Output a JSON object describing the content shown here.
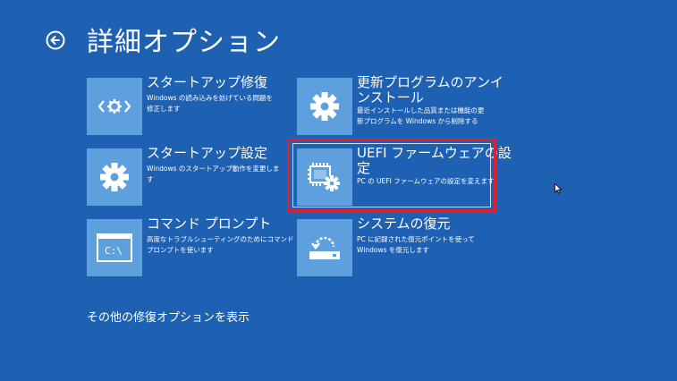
{
  "page": {
    "title": "詳細オプション",
    "more_options": "その他の修復オプションを表示"
  },
  "options": [
    {
      "title": "スタートアップ修復",
      "desc1": "Windows の読み込みを妨げている問題を",
      "desc2": "修正します",
      "icon": "repair-code-icon"
    },
    {
      "title": "更新プログラムのアンイ",
      "title2": "ンストール",
      "desc1": "最近インストールした品質または機能の更",
      "desc2": "新プログラムを Windows から削除する",
      "icon": "gear-icon"
    },
    {
      "title": "スタートアップ設定",
      "desc1": "Windows のスタートアップ動作を変更しま",
      "desc2": "す",
      "icon": "gear-icon"
    },
    {
      "title": "UEFI ファームウェアの設",
      "title2": "定",
      "desc1": "PC の UEFI ファームウェアの設定を変えます",
      "icon": "chip-gear-icon"
    },
    {
      "title": "コマンド プロンプト",
      "desc1": "高度なトラブルシューティングのためにコマンド",
      "desc2": "プロンプトを使います",
      "icon": "console-icon"
    },
    {
      "title": "システムの復元",
      "desc1": "PC に記録された復元ポイントを使って",
      "desc2": "Windows を復元します",
      "icon": "restore-icon",
      "console_text": "C:\\"
    }
  ],
  "console_prompt": "C:\\",
  "colors": {
    "background": "#1e61b2",
    "tile": "#5ea0dd",
    "highlight": "#e0202e"
  }
}
